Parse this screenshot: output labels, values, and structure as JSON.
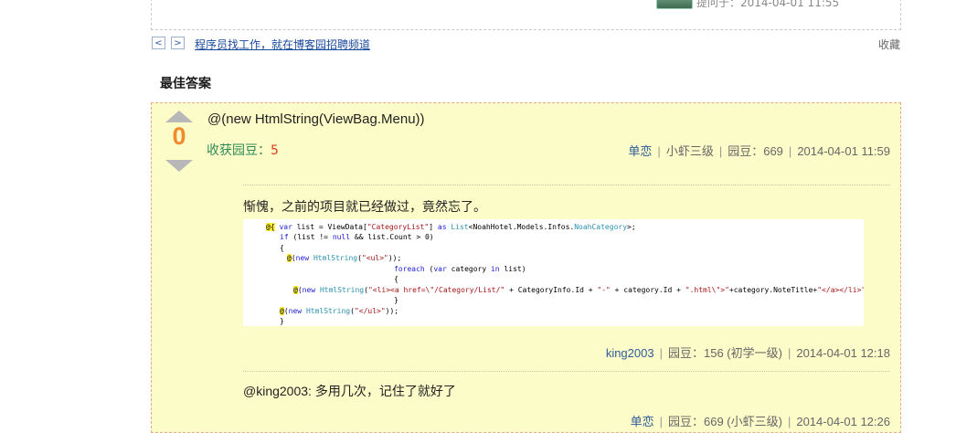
{
  "question": {
    "asked_at": "提问于：2014-04-01 11:55"
  },
  "nav": {
    "prev": "<",
    "next": ">",
    "job_link": "程序员找工作，就在博客园招聘频道",
    "favorite": "收藏"
  },
  "best_answer_title": "最佳答案",
  "answer": {
    "votes": "0",
    "text": "@(new HtmlString(ViewBag.Menu))",
    "reward_label": "收获园豆：",
    "reward_value": "5",
    "author": "单恋",
    "level": "小虾三级",
    "beans": "园豆：669",
    "time": "2014-04-01 11:59"
  },
  "comments": [
    {
      "text": "惭愧，之前的项目就已经做过，竟然忘了。",
      "author": "king2003",
      "beans": "园豆：156 (初学一级)",
      "time": "2014-04-01 12:18"
    },
    {
      "text": "@king2003: 多用几次，记住了就好了",
      "author": "单恋",
      "beans": "园豆：669 (小虾三级)",
      "time": "2014-04-01 12:26"
    }
  ],
  "code_lines": [
    "@{ var list = ViewData[\"CategoryList\"] as List<NoahHotel.Models.Infos.NoahCategory>;",
    "if (list != null && list.Count > 0)",
    "{",
    "@(new HtmlString(\"<ul>\"));",
    "foreach (var category in list)",
    "{",
    "@(new HtmlString(\"<li><a href=\\\"/Category/List/\" + CategoryInfo.Id + \"-\" + category.Id + \".html\\\">\"+category.NoteTitle+\"</a></li>\"));",
    "}",
    "@(new HtmlString(\"</ul>\"));",
    "}"
  ],
  "colors": {
    "panel_bg": "#fcfcc9",
    "panel_border": "#e7a98f",
    "vote_count": "#f08a2c",
    "reward_label": "#2e8b57",
    "reward_value": "#d93c1f",
    "link": "#2e5c99"
  }
}
